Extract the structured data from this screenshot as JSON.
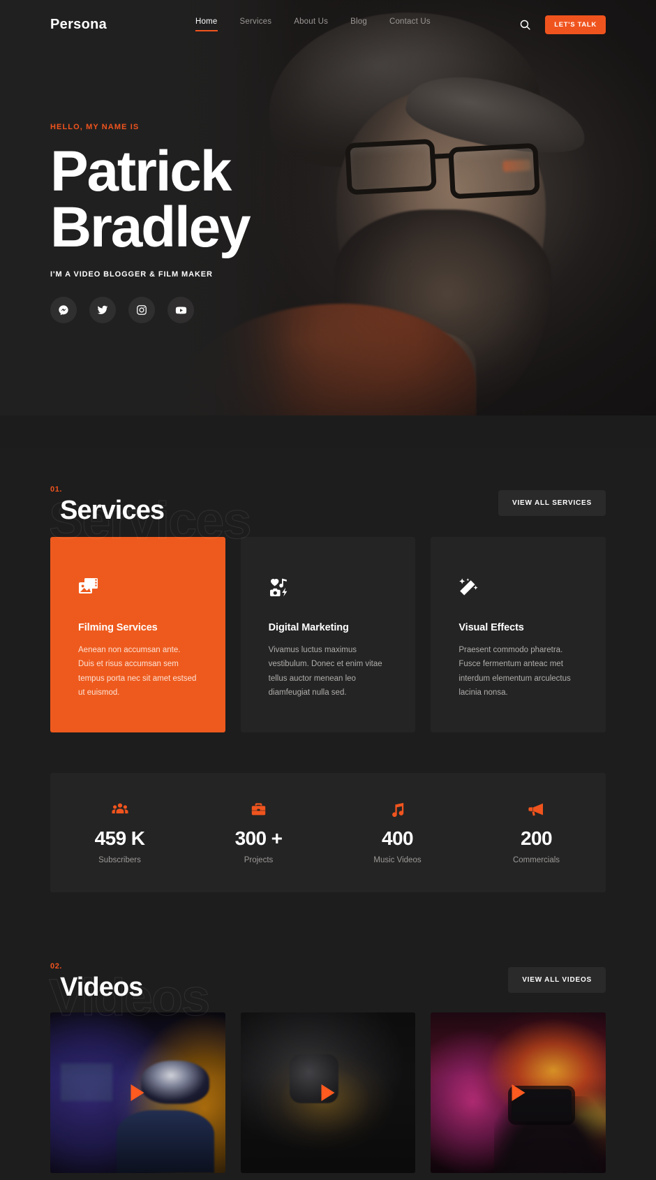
{
  "brand": {
    "name": "Persona"
  },
  "nav": {
    "links": [
      {
        "label": "Home",
        "active": true
      },
      {
        "label": "Services",
        "active": false
      },
      {
        "label": "About Us",
        "active": false
      },
      {
        "label": "Blog",
        "active": false
      },
      {
        "label": "Contact Us",
        "active": false
      }
    ],
    "search_icon": "search-icon",
    "cta_label": "LET'S TALK"
  },
  "hero": {
    "eyebrow": "HELLO, MY NAME IS",
    "name_line1": "Patrick",
    "name_line2": "Bradley",
    "role": "I'M A VIDEO BLOGGER & FILM MAKER",
    "socials": [
      {
        "name": "messenger-icon",
        "label": "Messenger"
      },
      {
        "name": "twitter-icon",
        "label": "Twitter"
      },
      {
        "name": "instagram-icon",
        "label": "Instagram"
      },
      {
        "name": "youtube-icon",
        "label": "YouTube"
      }
    ],
    "portrait_alt": "Bearded man with glasses and flat cap"
  },
  "services_section": {
    "number": "01.",
    "title": "Services",
    "ghost_title": "Services",
    "button_label": "VIEW ALL SERVICES",
    "cards": [
      {
        "icon": "film-image-icon",
        "title": "Filming Services",
        "text": "Aenean non accumsan ante. Duis et risus accumsan sem tempus porta nec sit amet estsed ut euismod.",
        "featured": true
      },
      {
        "icon": "media-grid-icon",
        "title": "Digital Marketing",
        "text": "Vivamus luctus maximus vestibulum. Donec et enim vitae tellus auctor menean leo diamfeugiat nulla sed.",
        "featured": false
      },
      {
        "icon": "magic-wand-icon",
        "title": "Visual Effects",
        "text": "Praesent commodo pharetra. Fusce fermentum anteac met interdum elementum arculectus lacinia nonsa.",
        "featured": false
      }
    ]
  },
  "stats": [
    {
      "icon": "users-icon",
      "value": "459 K",
      "label": "Subscribers"
    },
    {
      "icon": "briefcase-icon",
      "value": "300 +",
      "label": "Projects"
    },
    {
      "icon": "music-note-icon",
      "value": "400",
      "label": "Music Videos"
    },
    {
      "icon": "megaphone-icon",
      "value": "200",
      "label": "Commercials"
    }
  ],
  "videos_section": {
    "number": "02.",
    "title": "Videos",
    "ghost_title": "Videos",
    "button_label": "VIEW ALL VIDEOS",
    "items": [
      {
        "alt": "Child wearing VR headset in neon room",
        "play_icon": "play-icon"
      },
      {
        "alt": "Dark smartphone camera close-up",
        "play_icon": "play-icon"
      },
      {
        "alt": "Phone filming a concert with stage lights",
        "play_icon": "play-icon"
      }
    ]
  },
  "colors": {
    "accent": "#f0541e",
    "accent_card": "#ee5a1d",
    "play": "#ff5a1f",
    "page_bg": "#1d1d1d",
    "card_bg": "#242424",
    "button_bg": "#2a2a2a"
  }
}
